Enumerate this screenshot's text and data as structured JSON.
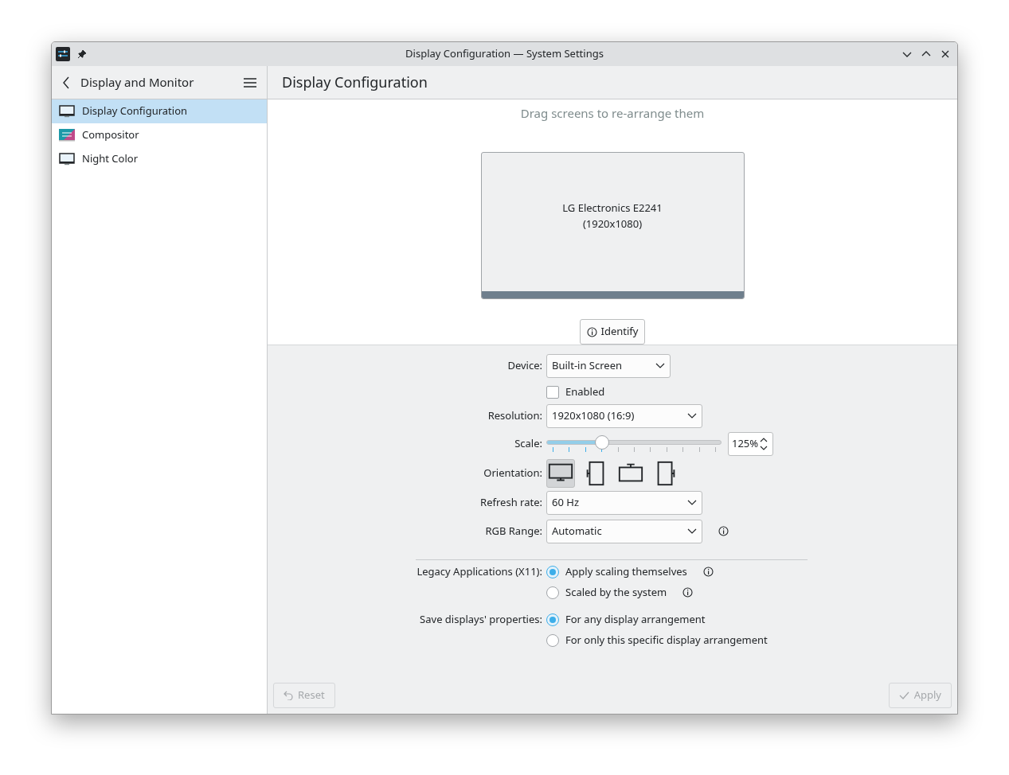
{
  "window": {
    "title": "Display Configuration — System Settings"
  },
  "sidebar": {
    "title": "Display and Monitor",
    "items": [
      {
        "label": "Display Configuration",
        "kind": "monitor",
        "selected": true
      },
      {
        "label": "Compositor",
        "kind": "compositor",
        "selected": false
      },
      {
        "label": "Night Color",
        "kind": "monitor",
        "selected": false
      }
    ]
  },
  "page_title": "Display Configuration",
  "hint": "Drag screens to re-arrange them",
  "screen": {
    "name": "LG Electronics E2241",
    "resolution": "(1920x1080)"
  },
  "identify_button": "Identify",
  "form": {
    "device": {
      "label": "Device:",
      "value": "Built-in Screen"
    },
    "enabled": {
      "label": "Enabled",
      "checked": false
    },
    "resolution": {
      "label": "Resolution:",
      "value": "1920x1080 (16:9)"
    },
    "scale": {
      "label": "Scale:",
      "level": 0.32,
      "value": "125%"
    },
    "orientation": {
      "label": "Orientation:",
      "options": [
        {
          "kind": "normal",
          "selected": true
        },
        {
          "kind": "left",
          "selected": false
        },
        {
          "kind": "inverted",
          "selected": false
        },
        {
          "kind": "right",
          "selected": false
        }
      ]
    },
    "refresh_rate": {
      "label": "Refresh rate:",
      "value": "60 Hz"
    },
    "rgb_range": {
      "label": "RGB Range:",
      "value": "Automatic"
    },
    "legacy": {
      "label": "Legacy Applications (X11):",
      "options": [
        {
          "label": "Apply scaling themselves",
          "selected": true
        },
        {
          "label": "Scaled by the system",
          "selected": false
        }
      ]
    },
    "save": {
      "label": "Save displays' properties:",
      "options": [
        {
          "label": "For any display arrangement",
          "selected": true
        },
        {
          "label": "For only this specific display arrangement",
          "selected": false
        }
      ]
    }
  },
  "footer": {
    "reset": {
      "label": "Reset",
      "disabled": true
    },
    "apply": {
      "label": "Apply",
      "disabled": true
    }
  }
}
